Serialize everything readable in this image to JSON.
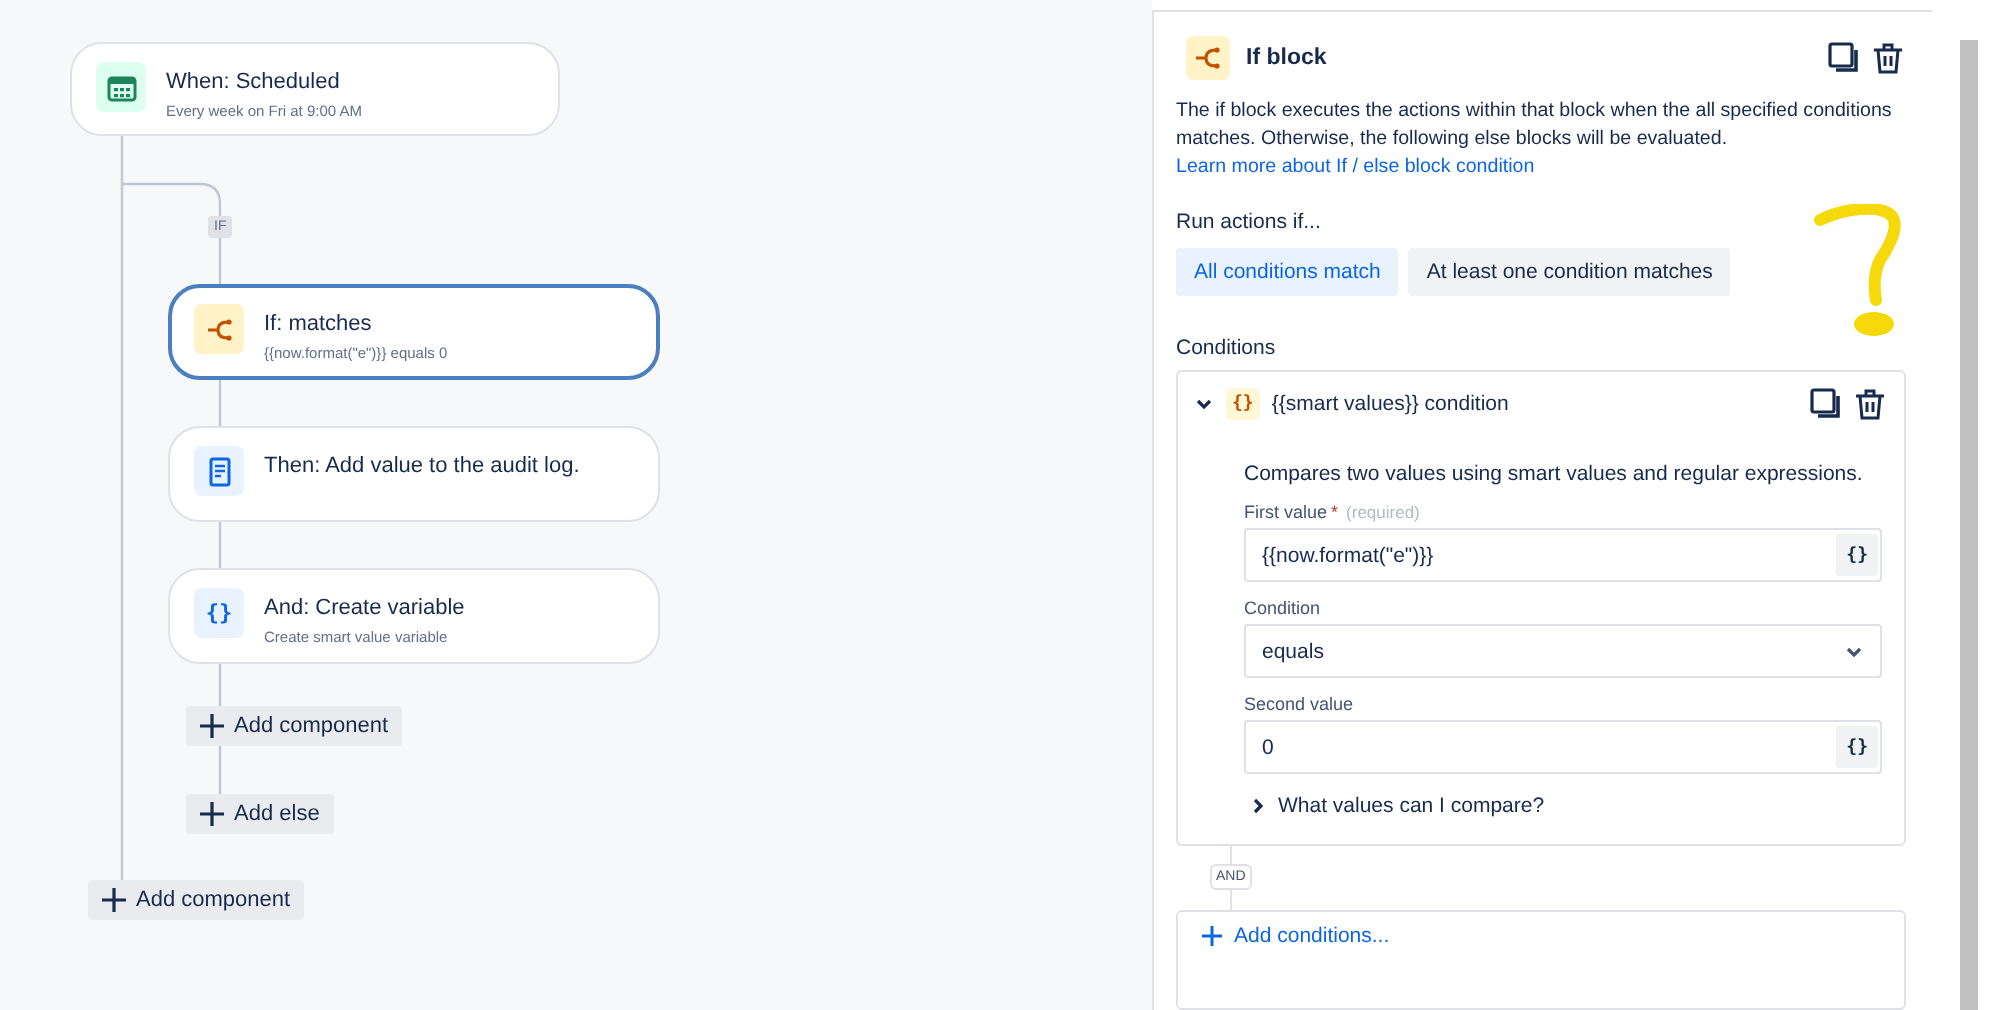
{
  "canvas": {
    "trigger": {
      "kind": "schedule",
      "title": "When: Scheduled",
      "subtitle": "Every week on Fri at 9:00 AM"
    },
    "branch_label": "IF",
    "nodes": [
      {
        "kind": "condition",
        "title": "If: matches",
        "subtitle": "{{now.format(\"e\")}} equals 0",
        "selected": true
      },
      {
        "kind": "log",
        "title": "Then: Add value to the audit log.",
        "selected": false
      },
      {
        "kind": "variable",
        "icon_text": "{}",
        "title": "And: Create variable",
        "subtitle": "Create smart value variable",
        "selected": false
      }
    ],
    "branch_buttons": [
      "Add component",
      "Add else"
    ],
    "add_component": "Add component"
  },
  "panel": {
    "title": "If block",
    "description": "The if block executes the actions within that block when the all specified conditions matches. Otherwise, the following else blocks will be evaluated.",
    "learn_more": "Learn more about If / else block condition",
    "run_label": "Run actions if...",
    "match_options": [
      {
        "label": "All conditions match",
        "selected": true
      },
      {
        "label": "At least one condition matches",
        "selected": false
      }
    ],
    "conditions_label": "Conditions",
    "condition": {
      "expanded": true,
      "icon_text": "{}",
      "title": "{{smart values}} condition",
      "description": "Compares two values using smart values and regular expressions.",
      "fields": [
        {
          "kind": "text",
          "label": "First value",
          "required_mark": "*",
          "hint": "(required)",
          "value": "{{now.format(\"e\")}}",
          "button_text": "{}"
        },
        {
          "kind": "select",
          "label": "Condition",
          "value": "equals"
        },
        {
          "kind": "text",
          "label": "Second value",
          "value": "0",
          "button_text": "{}"
        }
      ],
      "help": {
        "expanded": false,
        "label": "What values can I compare?"
      }
    },
    "joiner": "AND",
    "add_conditions": "Add conditions..."
  }
}
